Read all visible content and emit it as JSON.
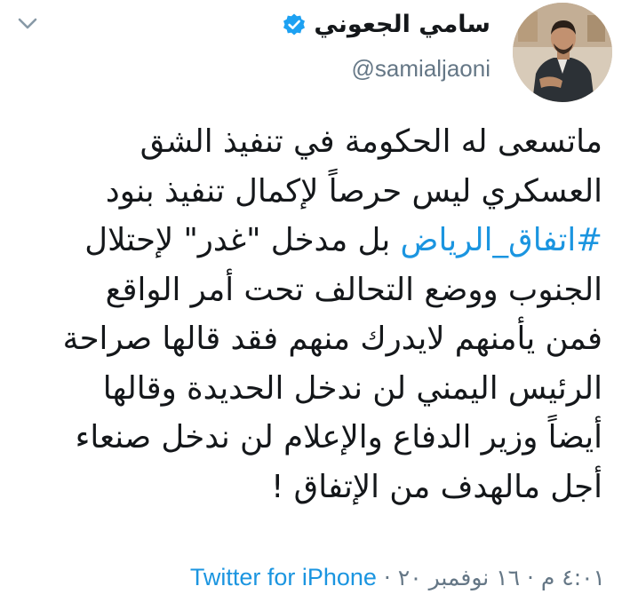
{
  "author": {
    "name": "سامي الجعوني",
    "handle": "@samialjaoni",
    "verified": true
  },
  "tweet": {
    "line1": "ماتسعى له الحكومة في تنفيذ الشق",
    "line2": "العسكري ليس حرصاً لإكمال تنفيذ بنود",
    "line3_hashtag": "#اتفاق_الرياض",
    "line3_rest": " بل مدخل \"غدر\" لإحتلال",
    "line4": "الجنوب ووضع التحالف تحت أمر الواقع",
    "line5": "فمن يأمنهم لايدرك منهم فقد قالها صراحة",
    "line6": "الرئيس اليمني لن ندخل الحديدة وقالها",
    "line7": "أيضاً وزير الدفاع والإعلام لن ندخل صنعاء",
    "line8": "أجل مالهدف من الإتفاق !"
  },
  "meta": {
    "time": "٤:٠١ م",
    "separator1": " · ",
    "date": "١٦ نوفمبر ٢٠",
    "separator2": " · ",
    "source": "Twitter for iPhone"
  },
  "colors": {
    "link": "#1b95e0",
    "secondary": "#657786",
    "text": "#14171a"
  },
  "icons": {
    "menu": "chevron-down-icon",
    "verified": "verified-badge-icon"
  }
}
